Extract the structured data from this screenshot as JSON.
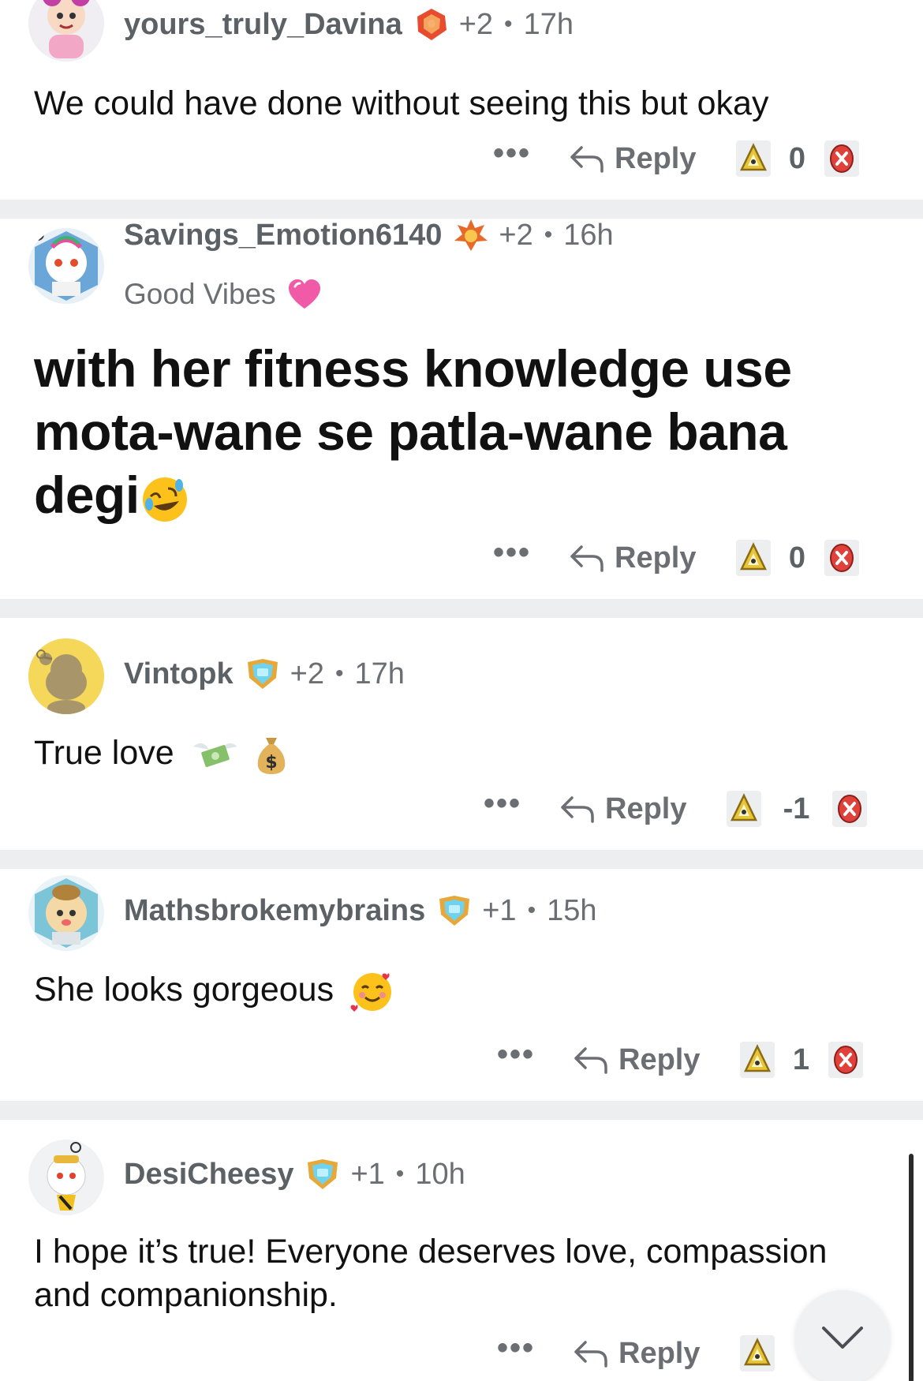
{
  "comments": [
    {
      "username": "yours_truly_Davina",
      "karma": "+2",
      "time": "17h",
      "text": "We could have done without seeing this but okay",
      "reply_label": "Reply",
      "score": "0"
    },
    {
      "username": "Savings_Emotion6140",
      "karma": "+2",
      "time": "16h",
      "flair": "Good Vibes",
      "text": "with her fitness knowledge use mota-wane se patla-wane bana degi",
      "reply_label": "Reply",
      "score": "0"
    },
    {
      "username": "Vintopk",
      "karma": "+2",
      "time": "17h",
      "text": "True love",
      "reply_label": "Reply",
      "score": "-1"
    },
    {
      "username": "Mathsbrokemybrains",
      "karma": "+1",
      "time": "15h",
      "text": "She looks gorgeous",
      "reply_label": "Reply",
      "score": "1"
    },
    {
      "username": "DesiCheesy",
      "karma": "+1",
      "time": "10h",
      "text": "I hope it’s true! Everyone deserves love, compassion and companionship.",
      "reply_label": "Reply"
    }
  ],
  "separator": "•",
  "more_label": "•••",
  "colors": {
    "divider": "#edeef0",
    "meta_text": "#6b6f73",
    "downvote": "#e0413a",
    "upvote": "#e8c43a"
  },
  "icons": {
    "reply": "reply-arrow-icon",
    "upvote": "upvote-triangle-icon",
    "downvote": "downvote-x-icon",
    "collapse": "chevron-down-icon"
  }
}
